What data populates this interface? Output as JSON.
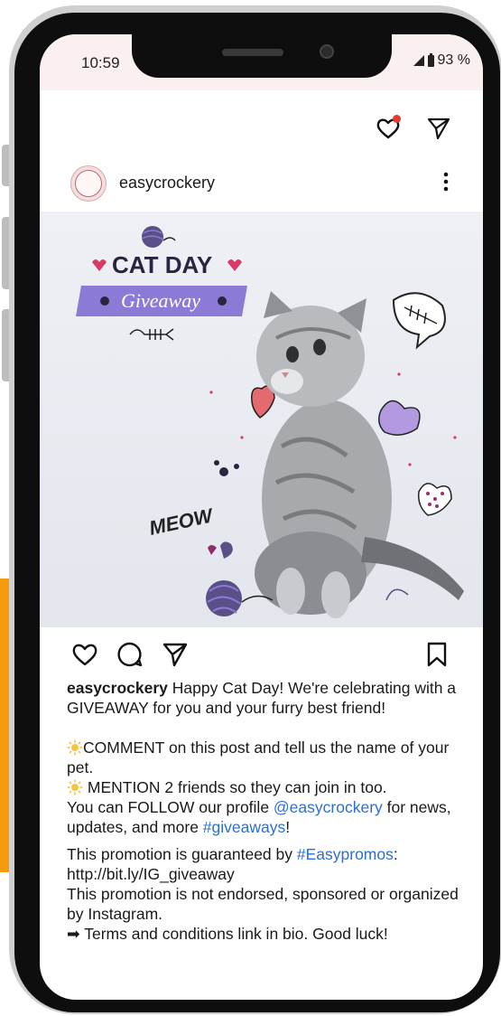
{
  "status": {
    "time": "10:59",
    "battery": "93 %"
  },
  "post": {
    "username": "easycrockery",
    "image_text": {
      "title": "CAT DAY",
      "subtitle": "Giveaway",
      "meow": "MEOW"
    },
    "caption": {
      "username": "easycrockery",
      "intro": " Happy Cat Day! We're celebrating with a GIVEAWAY for you and your furry best friend!",
      "comment": "COMMENT on this post and tell us the name of your pet.",
      "mention": " MENTION 2 friends so they can join in too.",
      "follow_prefix": "You can FOLLOW our profile ",
      "follow_handle": "@easycrockery",
      "follow_middle": " for news, updates, and more ",
      "follow_tag": "#giveaways",
      "follow_end": "!",
      "guarantee_prefix": "This promotion is guaranteed by ",
      "guarantee_tag": "#Easypromos",
      "guarantee_end": ":",
      "url": "http://bit.ly/IG_giveaway",
      "disclaimer": "This promotion is not endorsed, sponsored or organized by Instagram.",
      "terms": "➡ Terms and conditions link in bio. Good luck!"
    }
  },
  "colors": {
    "accent_orange": "#f59a0b",
    "link_blue": "#2d6fd0",
    "notification_red": "#e53935",
    "banner_purple": "#8c7ad6"
  },
  "icons": [
    "heart-icon",
    "send-icon",
    "more-icon",
    "like-icon",
    "comment-icon",
    "share-icon",
    "bookmark-icon"
  ]
}
